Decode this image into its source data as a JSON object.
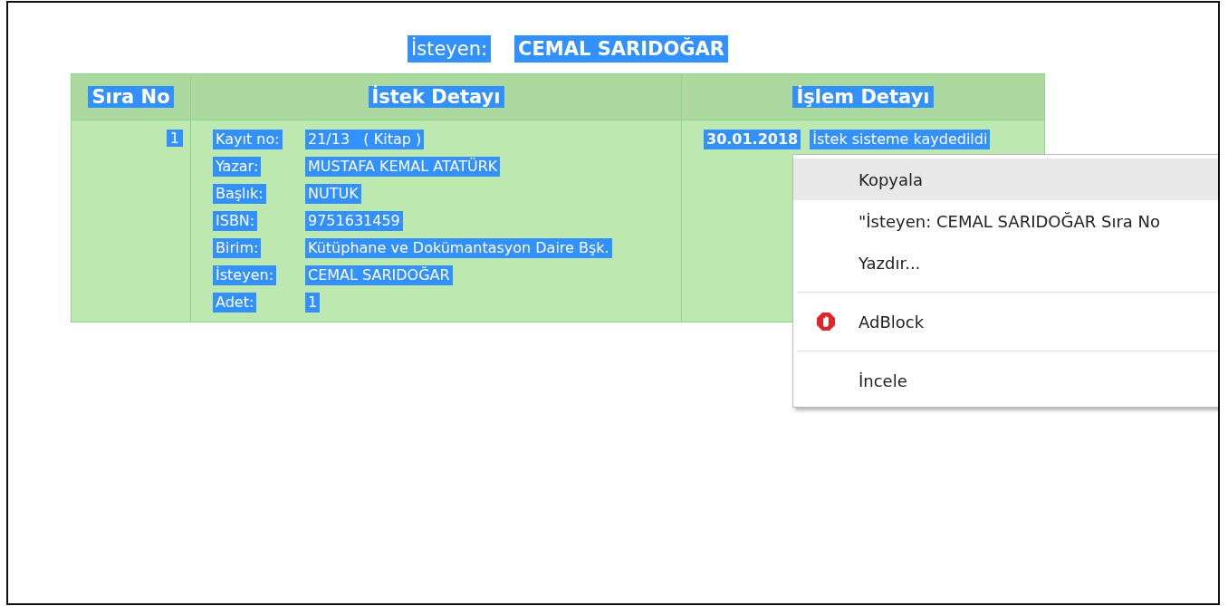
{
  "text_selected": true,
  "heading": {
    "label": "İsteyen:",
    "value": "CEMAL SARIDOĞAR"
  },
  "table": {
    "columns": [
      "Sıra No",
      "İstek Detayı",
      "İşlem Detayı"
    ],
    "rows": [
      {
        "number": "1",
        "details": [
          {
            "label": "Kayıt no:",
            "value": "21/13   ( Kitap )"
          },
          {
            "label": "Yazar:",
            "value": "MUSTAFA KEMAL ATATÜRK"
          },
          {
            "label": "Başlık:",
            "value": "NUTUK"
          },
          {
            "label": "ISBN:",
            "value": "9751631459"
          },
          {
            "label": "Birim:",
            "value": "Kütüphane ve Dokümantasyon Daire Bşk."
          },
          {
            "label": "İsteyen:",
            "value": "CEMAL SARIDOĞAR"
          },
          {
            "label": "Adet:",
            "value": "1"
          }
        ],
        "process": {
          "date": "30.01.2018",
          "note": "İstek sisteme kaydedildi"
        }
      }
    ]
  },
  "context_menu": {
    "items": [
      {
        "kind": "item",
        "label": "Kopyala",
        "selected": true
      },
      {
        "kind": "item",
        "label": "\"İsteyen: CEMAL SARIDOĞAR Sıra No",
        "selected": false
      },
      {
        "kind": "item",
        "label": "Yazdır...",
        "selected": false
      },
      {
        "kind": "separator"
      },
      {
        "kind": "extension",
        "label": "AdBlock",
        "selected": false
      },
      {
        "kind": "separator"
      },
      {
        "kind": "item",
        "label": "İncele",
        "selected": false
      }
    ]
  }
}
